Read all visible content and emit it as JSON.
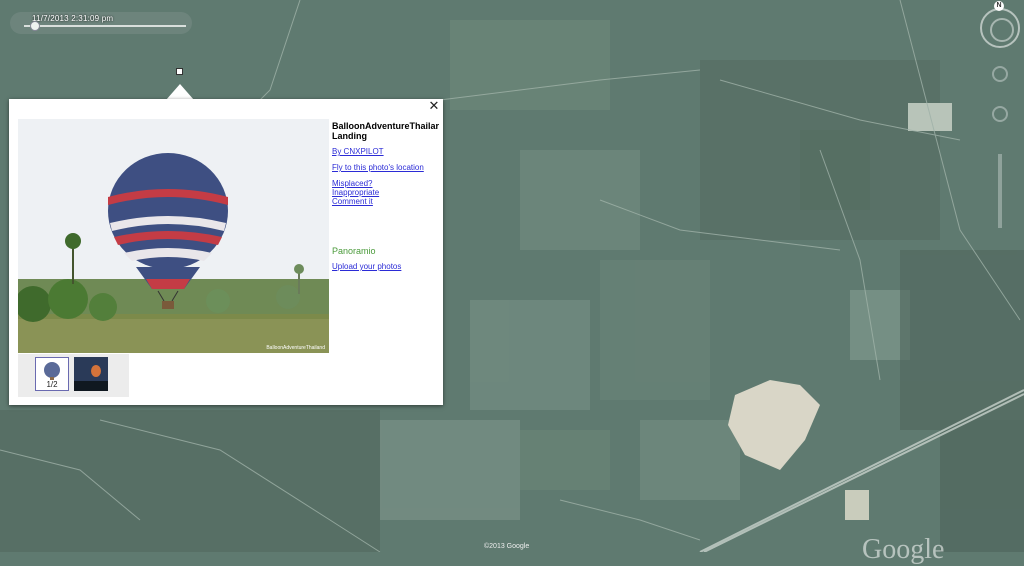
{
  "time_slider": {
    "date_label": "11/7/2013  2:31:09 pm"
  },
  "navigation": {
    "north_label": "N"
  },
  "popup": {
    "title_line1": "BalloonAdventureThailar",
    "title_line2": "Landing",
    "author_link": "By CNXPILOT",
    "fly_link": "Fly to this photo's location",
    "misplaced_link": "Misplaced?",
    "inappropriate_link": "Inappropriate",
    "comment_link": "Comment it",
    "panoramio_brand": "Panoramio",
    "upload_link": "Upload your photos",
    "photo_caption": "BalloonAdventureThailand",
    "thumb_counter": "1/2",
    "close_label": "✕"
  },
  "attribution": {
    "copyright": "©2013 Google",
    "logo": "Google"
  },
  "colors": {
    "map_base": "#5f7a70",
    "link": "#2b2bd6",
    "panoramio_green": "#4a9a3a"
  }
}
